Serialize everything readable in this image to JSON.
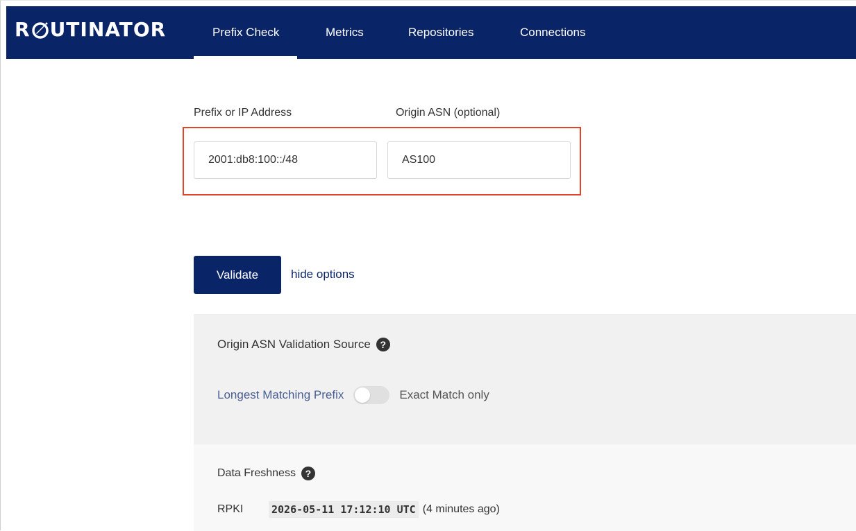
{
  "app": {
    "logo_text_left": "R",
    "logo_text_right": "UTINATOR",
    "brand_color": "#0a2468"
  },
  "nav": {
    "tabs": [
      {
        "label": "Prefix Check",
        "active": true
      },
      {
        "label": "Metrics",
        "active": false
      },
      {
        "label": "Repositories",
        "active": false
      },
      {
        "label": "Connections",
        "active": false
      }
    ]
  },
  "form": {
    "prefix_label": "Prefix or IP Address",
    "prefix_value": "2001:db8:100::/48",
    "asn_label": "Origin ASN (optional)",
    "asn_value": "AS100",
    "highlight_color": "#e0452a"
  },
  "actions": {
    "validate_label": "Validate",
    "hide_options_label": "hide options"
  },
  "options": {
    "title": "Origin ASN Validation Source",
    "help_icon": "question-circle-icon",
    "toggle_left_label": "Longest Matching Prefix",
    "toggle_right_label": "Exact Match only",
    "toggle_on": false
  },
  "freshness": {
    "title": "Data Freshness",
    "rpki_label": "RPKI",
    "rpki_time": "2026-05-11 17:12:10 UTC",
    "rpki_ago": "(4 minutes ago)"
  }
}
